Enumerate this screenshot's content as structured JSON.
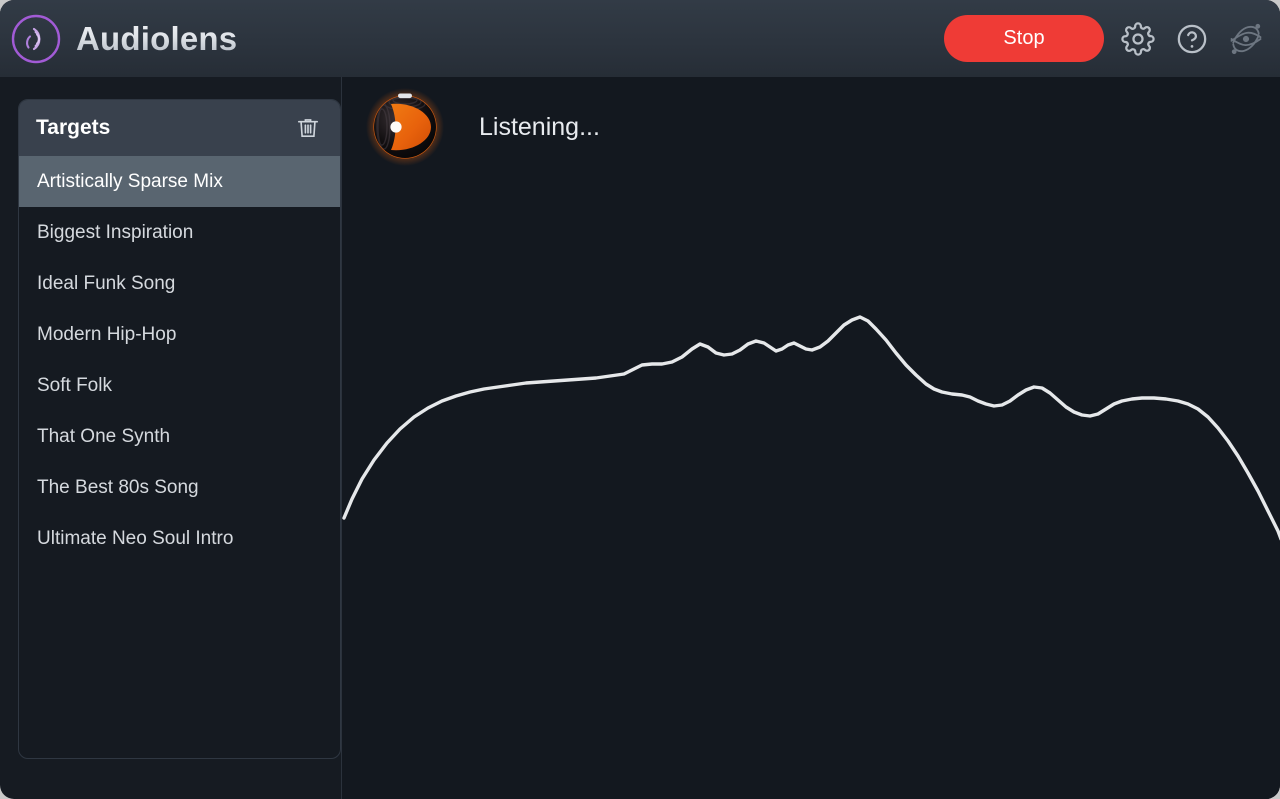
{
  "app": {
    "name": "Audiolens",
    "logo_icon": "audio-waves-circle-icon",
    "accent_purple": "#a25bd6",
    "window_bg": "#161b22"
  },
  "titlebar": {
    "stop_label": "Stop",
    "stop_color": "#ef3b36",
    "settings_icon": "gear-icon",
    "help_icon": "question-mark-circle-icon",
    "analysis_icon": "atom-network-icon"
  },
  "sidebar": {
    "title": "Targets",
    "delete_icon": "trash-icon",
    "selected_index": 0,
    "selected_bg": "#596570",
    "items": [
      {
        "label": "Artistically Sparse Mix"
      },
      {
        "label": "Biggest Inspiration"
      },
      {
        "label": "Ideal Funk Song"
      },
      {
        "label": "Modern Hip-Hop"
      },
      {
        "label": "Soft Folk"
      },
      {
        "label": "That One Synth"
      },
      {
        "label": "The Best 80s Song"
      },
      {
        "label": "Ultimate Neo Soul Intro"
      }
    ]
  },
  "main": {
    "status_text": "Listening...",
    "status_icon": "eye-lens-orange-icon",
    "status_icon_color": "#e8620c"
  },
  "chart_data": {
    "type": "line",
    "title": "",
    "xlabel": "",
    "ylabel": "",
    "grid": false,
    "legend": null,
    "line_color": "#e6e8ea",
    "line_width": 3.4,
    "xlim": [
      0,
      939
    ],
    "ylim": [
      0,
      722
    ],
    "series": [
      {
        "name": "spectrum",
        "points": [
          [
            2,
            441
          ],
          [
            10,
            422
          ],
          [
            20,
            402
          ],
          [
            32,
            383
          ],
          [
            45,
            366
          ],
          [
            58,
            352
          ],
          [
            72,
            340
          ],
          [
            86,
            331
          ],
          [
            100,
            324
          ],
          [
            114,
            319
          ],
          [
            128,
            315
          ],
          [
            142,
            312
          ],
          [
            156,
            310
          ],
          [
            170,
            308
          ],
          [
            184,
            306
          ],
          [
            198,
            305
          ],
          [
            212,
            304
          ],
          [
            226,
            303
          ],
          [
            240,
            302
          ],
          [
            254,
            301
          ],
          [
            268,
            299
          ],
          [
            282,
            297
          ],
          [
            292,
            292
          ],
          [
            300,
            288
          ],
          [
            310,
            287
          ],
          [
            320,
            287
          ],
          [
            330,
            285
          ],
          [
            340,
            280
          ],
          [
            350,
            272
          ],
          [
            358,
            267
          ],
          [
            366,
            270
          ],
          [
            374,
            276
          ],
          [
            382,
            278
          ],
          [
            390,
            277
          ],
          [
            398,
            273
          ],
          [
            406,
            267
          ],
          [
            414,
            264
          ],
          [
            422,
            266
          ],
          [
            428,
            270
          ],
          [
            434,
            274
          ],
          [
            440,
            272
          ],
          [
            446,
            268
          ],
          [
            452,
            266
          ],
          [
            458,
            269
          ],
          [
            464,
            272
          ],
          [
            470,
            273
          ],
          [
            478,
            270
          ],
          [
            486,
            264
          ],
          [
            494,
            256
          ],
          [
            502,
            248
          ],
          [
            510,
            243
          ],
          [
            518,
            240
          ],
          [
            526,
            244
          ],
          [
            534,
            252
          ],
          [
            544,
            263
          ],
          [
            554,
            276
          ],
          [
            564,
            288
          ],
          [
            574,
            298
          ],
          [
            584,
            307
          ],
          [
            592,
            312
          ],
          [
            600,
            315
          ],
          [
            610,
            317
          ],
          [
            620,
            318
          ],
          [
            628,
            320
          ],
          [
            636,
            324
          ],
          [
            644,
            327
          ],
          [
            652,
            329
          ],
          [
            660,
            328
          ],
          [
            668,
            324
          ],
          [
            676,
            318
          ],
          [
            684,
            313
          ],
          [
            692,
            310
          ],
          [
            700,
            311
          ],
          [
            708,
            316
          ],
          [
            716,
            323
          ],
          [
            724,
            330
          ],
          [
            732,
            335
          ],
          [
            740,
            338
          ],
          [
            748,
            339
          ],
          [
            756,
            337
          ],
          [
            764,
            332
          ],
          [
            772,
            327
          ],
          [
            780,
            324
          ],
          [
            790,
            322
          ],
          [
            800,
            321
          ],
          [
            812,
            321
          ],
          [
            824,
            322
          ],
          [
            836,
            324
          ],
          [
            846,
            327
          ],
          [
            856,
            332
          ],
          [
            866,
            340
          ],
          [
            876,
            351
          ],
          [
            886,
            364
          ],
          [
            896,
            379
          ],
          [
            906,
            396
          ],
          [
            916,
            414
          ],
          [
            926,
            434
          ],
          [
            936,
            454
          ],
          [
            939,
            462
          ]
        ]
      }
    ]
  }
}
